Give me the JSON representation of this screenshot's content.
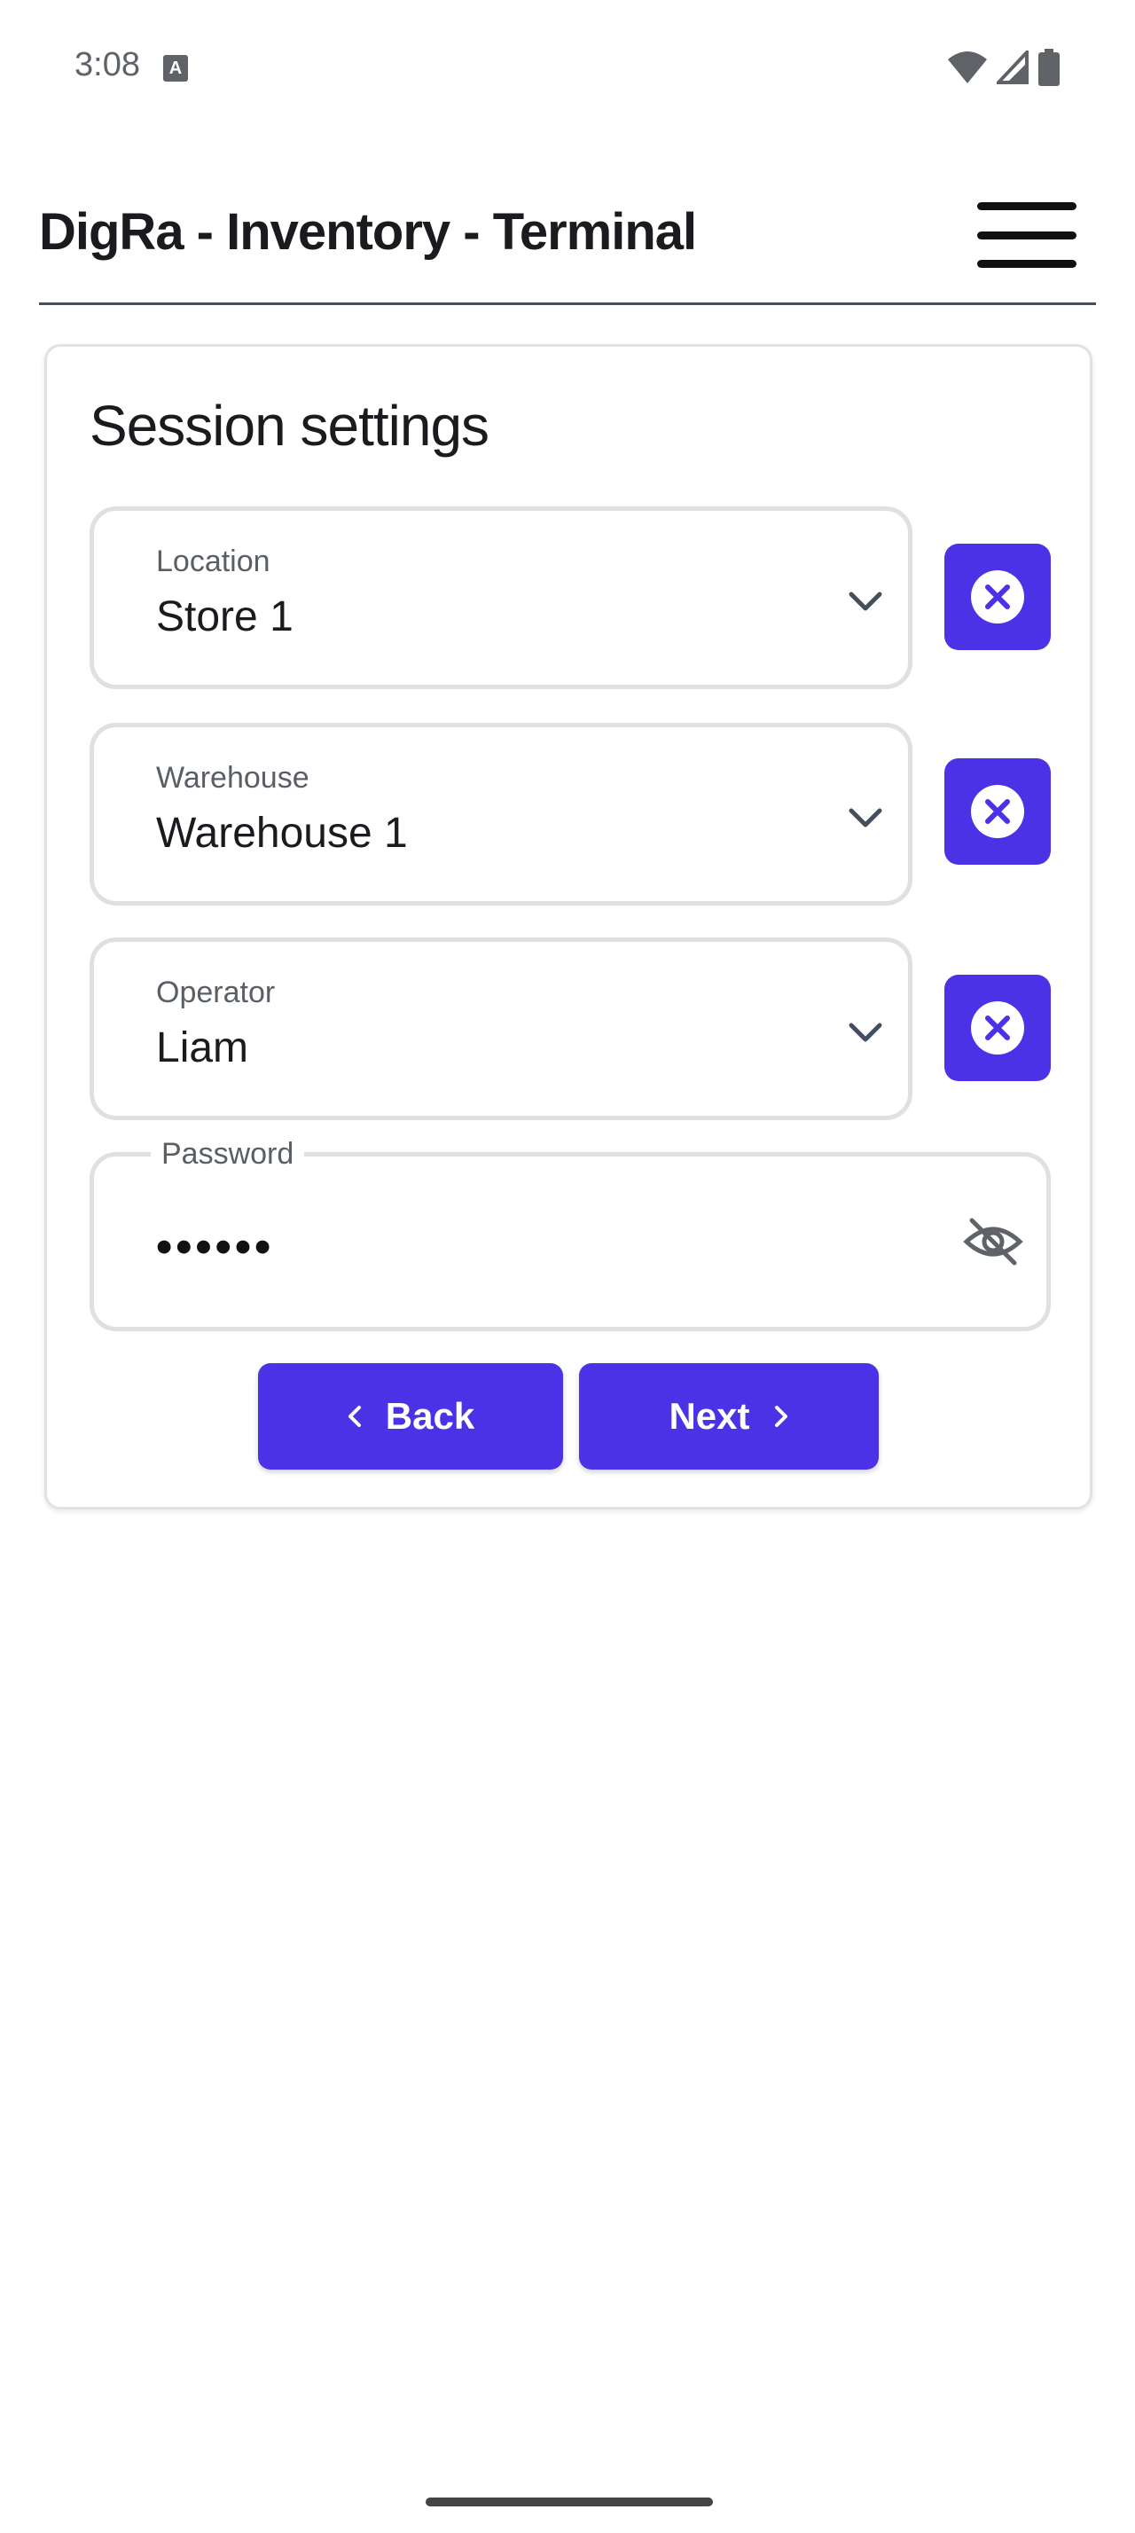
{
  "status_bar": {
    "time": "3:08",
    "notification_icon": "A"
  },
  "header": {
    "title": "DigRa - Inventory - Terminal",
    "menu_icon": "hamburger-menu-icon"
  },
  "form": {
    "title": "Session settings",
    "location": {
      "label": "Location",
      "value": "Store 1"
    },
    "warehouse": {
      "label": "Warehouse",
      "value": "Warehouse 1"
    },
    "operator": {
      "label": "Operator",
      "value": "Liam"
    },
    "password": {
      "label": "Password",
      "masked_value": "••••••"
    }
  },
  "actions": {
    "back_label": "Back",
    "next_label": "Next"
  },
  "colors": {
    "accent": "#4b32e6",
    "text": "#1b1b1f",
    "muted": "#5a5f66",
    "border": "#e0e0e4"
  }
}
